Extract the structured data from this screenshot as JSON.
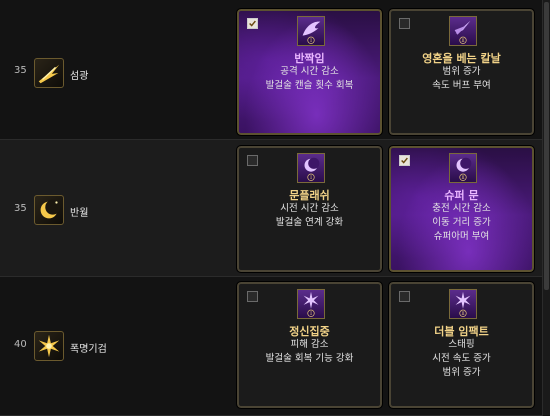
{
  "rows": [
    {
      "level": "35",
      "skill": "섬광",
      "icon": "golden-flash-icon",
      "options": [
        {
          "title": "반짝임",
          "effects": [
            "공격 시간 감소",
            "발걸술 캔슬 횟수 회복"
          ],
          "selected": true,
          "numeral": "I"
        },
        {
          "title": "영혼을 베는 칼날",
          "effects": [
            "범위 증가",
            "속도 버프 부여"
          ],
          "selected": false,
          "numeral": "II"
        }
      ]
    },
    {
      "level": "35",
      "skill": "반월",
      "icon": "crescent-moon-icon",
      "options": [
        {
          "title": "문플래쉬",
          "effects": [
            "시전 시간 감소",
            "발걸술 연계 강화"
          ],
          "selected": false,
          "numeral": "I"
        },
        {
          "title": "슈퍼 문",
          "effects": [
            "충전 시간 감소",
            "이동 거리 증가",
            "슈퍼아머 부여"
          ],
          "selected": true,
          "numeral": "II"
        }
      ]
    },
    {
      "level": "40",
      "skill": "폭명기검",
      "icon": "star-burst-icon",
      "options": [
        {
          "title": "정신집중",
          "effects": [
            "피해 감소",
            "발걸술 회복 기능 강화"
          ],
          "selected": false,
          "numeral": "I"
        },
        {
          "title": "더블 임팩트",
          "effects": [
            "스태핑",
            "시전 속도 증가",
            "범위 증가"
          ],
          "selected": false,
          "numeral": "II"
        }
      ]
    }
  ],
  "colors": {
    "accent_gold": "#f2d388",
    "selected_purple": "#4a1a7a"
  }
}
